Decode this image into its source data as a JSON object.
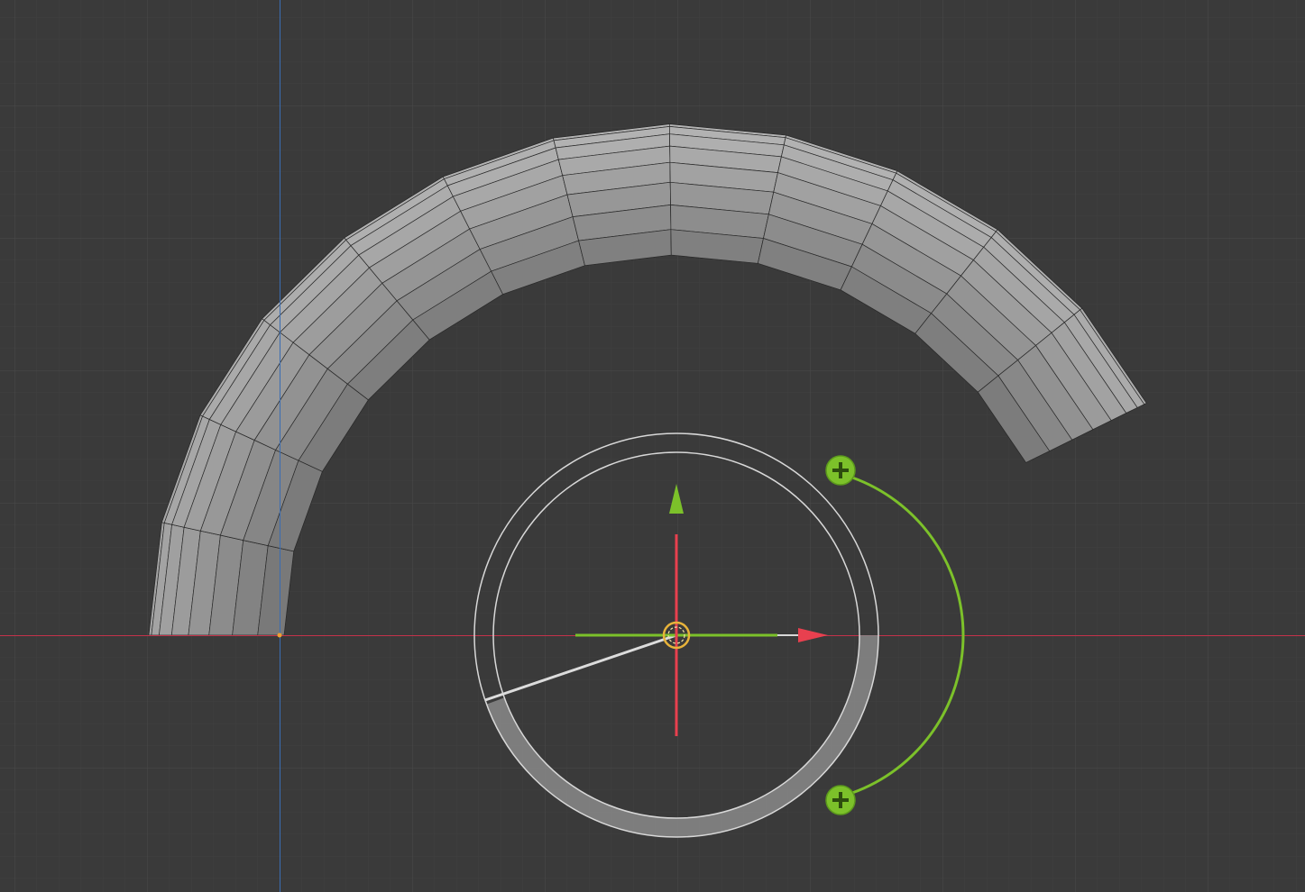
{
  "viewport": {
    "background": "#3a3a3a",
    "grid_minor_color": "#404040",
    "grid_major_color": "#474747",
    "axis_x_color": "#c4324a",
    "axis_y_color": "#3a6db3"
  },
  "mesh": {
    "type": "screw-arc-tube",
    "fill_light": "#b8b8b8",
    "fill_dark": "#5a5a5a",
    "wire_color": "#2a2a2a",
    "edge_highlight": "#ffffff"
  },
  "gizmo": {
    "type": "spin-tool",
    "x_axis_color": "#e8404f",
    "y_axis_color": "#7cc12a",
    "ring_color": "#d8d8d8",
    "arc_color": "#7cc12a",
    "handle_icon": "plus-circle-icon",
    "pivot_color": "#e8b33a"
  },
  "origin": {
    "marker_color": "#f0a030"
  }
}
